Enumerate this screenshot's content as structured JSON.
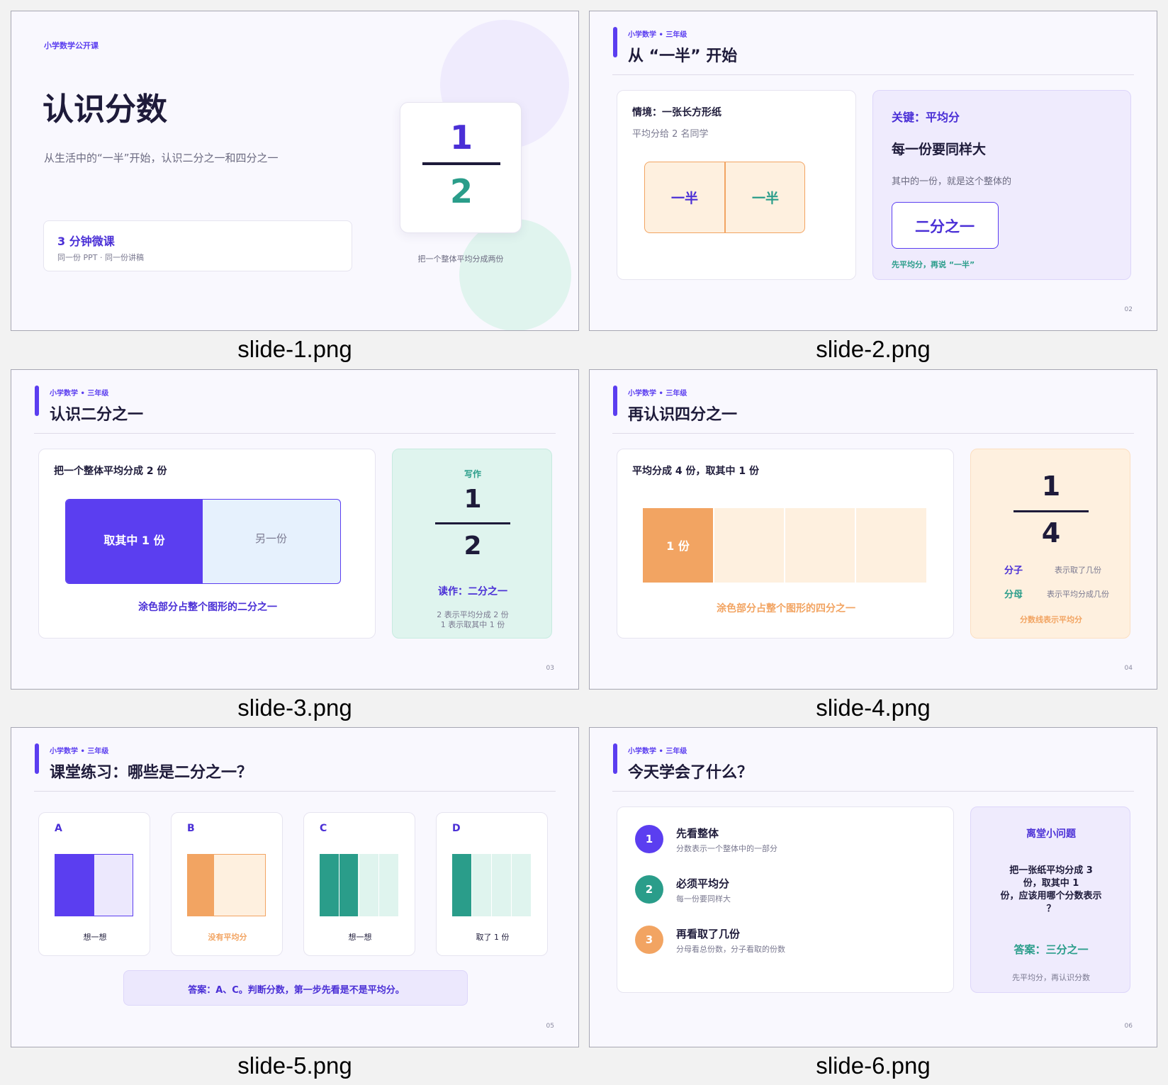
{
  "slides": [
    {
      "caption": "slide-1.png",
      "kicker": "小学数学公开课",
      "title": "认识分数",
      "subtitle": "从生活中的“一半”开始，认识二分之一和四分之一",
      "card_title": "3 分钟微课",
      "card_sub": "同一份 PPT · 同一份讲稿",
      "numerator": "1",
      "denominator": "2",
      "note": "把一个整体平均分成两份"
    },
    {
      "caption": "slide-2.png",
      "kicker": "小学数学 • 三年级",
      "title": "从 “一半” 开始",
      "scenario_title": "情境：一张长方形纸",
      "scenario_sub": "平均分给 2 名同学",
      "half_left": "一半",
      "half_right": "一半",
      "key_title": "关键：平均分",
      "key_head": "每一份要同样大",
      "key_text": "其中的一份，就是这个整体的",
      "key_box": "二分之一",
      "key_note": "先平均分，再说 “一半”",
      "page": "02"
    },
    {
      "caption": "slide-3.png",
      "kicker": "小学数学 • 三年级",
      "title": "认识二分之一",
      "card_title": "把一个整体平均分成 2 份",
      "bar_left": "取其中 1 份",
      "bar_right": "另一份",
      "bar_note": "涂色部分占整个图形的二分之一",
      "write_label": "写作",
      "numerator": "1",
      "denominator": "2",
      "read_label": "读作：二分之一",
      "expl_1": "2 表示平均分成 2 份",
      "expl_2": "1 表示取其中 1 份",
      "page": "03"
    },
    {
      "caption": "slide-4.png",
      "kicker": "小学数学 • 三年级",
      "title": "再认识四分之一",
      "card_title": "平均分成 4 份，取其中 1 份",
      "bar_label": "1 份",
      "bar_note": "涂色部分占整个图形的四分之一",
      "numerator": "1",
      "denominator": "4",
      "term_1": "分子",
      "term_1_desc": "表示取了几份",
      "term_2": "分母",
      "term_2_desc": "表示平均分成几份",
      "line_note": "分数线表示平均分",
      "page": "04"
    },
    {
      "caption": "slide-5.png",
      "kicker": "小学数学 • 三年级",
      "title": "课堂练习：哪些是二分之一？",
      "options": [
        {
          "letter": "A",
          "label": "想一想"
        },
        {
          "letter": "B",
          "label": "没有平均分"
        },
        {
          "letter": "C",
          "label": "想一想"
        },
        {
          "letter": "D",
          "label": "取了 1 份"
        }
      ],
      "answer": "答案：A、C。判断分数，第一步先看是不是平均分。",
      "page": "05"
    },
    {
      "caption": "slide-6.png",
      "kicker": "小学数学 • 三年级",
      "title": "今天学会了什么？",
      "steps": [
        {
          "n": "1",
          "title": "先看整体",
          "desc": "分数表示一个整体中的一部分"
        },
        {
          "n": "2",
          "title": "必须平均分",
          "desc": "每一份要同样大"
        },
        {
          "n": "3",
          "title": "再看取了几份",
          "desc": "分母看总份数，分子看取的份数"
        }
      ],
      "q_title": "离堂小问题",
      "q_line_1": "把一张纸平均分成 3",
      "q_line_2": "份，取其中 1",
      "q_line_3": "份，应该用哪个分数表示",
      "q_line_4": "？",
      "q_answer": "答案：三分之一",
      "q_note": "先平均分，再认识分数",
      "page": "06"
    }
  ],
  "colors": {
    "purple": "#5b3ef0",
    "teal": "#2a9d8a",
    "orange": "#f2a462",
    "navy": "#1e1b3a"
  }
}
